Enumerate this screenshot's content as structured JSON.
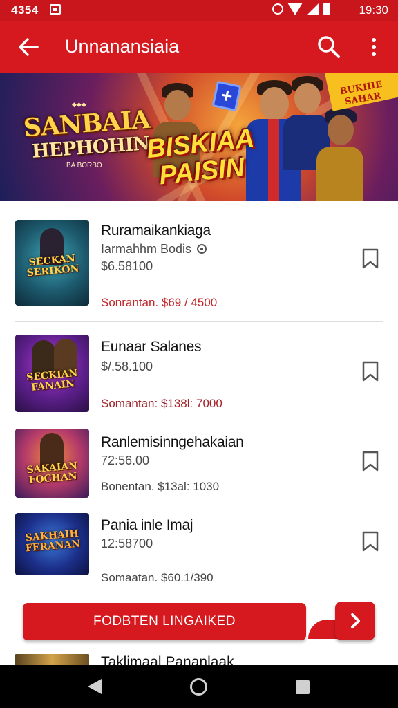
{
  "status_bar": {
    "time_left": "4354",
    "time_right": "19:30"
  },
  "app_bar": {
    "title": "Unnanansiaia",
    "back_icon": "arrow-left-icon",
    "search_icon": "search-icon",
    "more_icon": "more-vert-icon"
  },
  "banner": {
    "logo_line1": "SANBAIA",
    "logo_line2": "HEPHOHIN",
    "logo_small": "BA BORBO",
    "headline_line1": "BISKIAA",
    "headline_line2": "PAISIN",
    "corner_text": "BUKHIE SAHAR"
  },
  "items": [
    {
      "name": "Ruramaikankiaga",
      "subtitle": "Iarmahhm Bodis",
      "value": "$6.58100",
      "price": "Sonrantan. $69 / 4500",
      "thumb_text": "SECKAN SERIKON"
    },
    {
      "name": "Eunaar Salanes",
      "subtitle": "",
      "value": "$/.58.100",
      "price": "Somantan: $138l: 7000",
      "thumb_text": "SECKIAN FANAIN"
    },
    {
      "name": "Ranlemisinngehakaian",
      "subtitle": "",
      "value": "72:56.00",
      "price": "Bonentan. $13al: 1030",
      "thumb_text": "SAKAIAN FOCHAN"
    },
    {
      "name": "Pania inle Imaj",
      "subtitle": "",
      "value": "12:58700",
      "price": "Somaatan. $60.1/390",
      "thumb_text": "SAKHAIH FERANAN"
    }
  ],
  "cta": {
    "label": "FODBTEN LINGAIKED",
    "next_icon": "chevron-right-icon"
  },
  "peek_item": {
    "name": "Taklimaal Pananlaak"
  },
  "colors": {
    "primary": "#d6191f",
    "status_bar": "#c8161c",
    "price": "#c0262a"
  }
}
